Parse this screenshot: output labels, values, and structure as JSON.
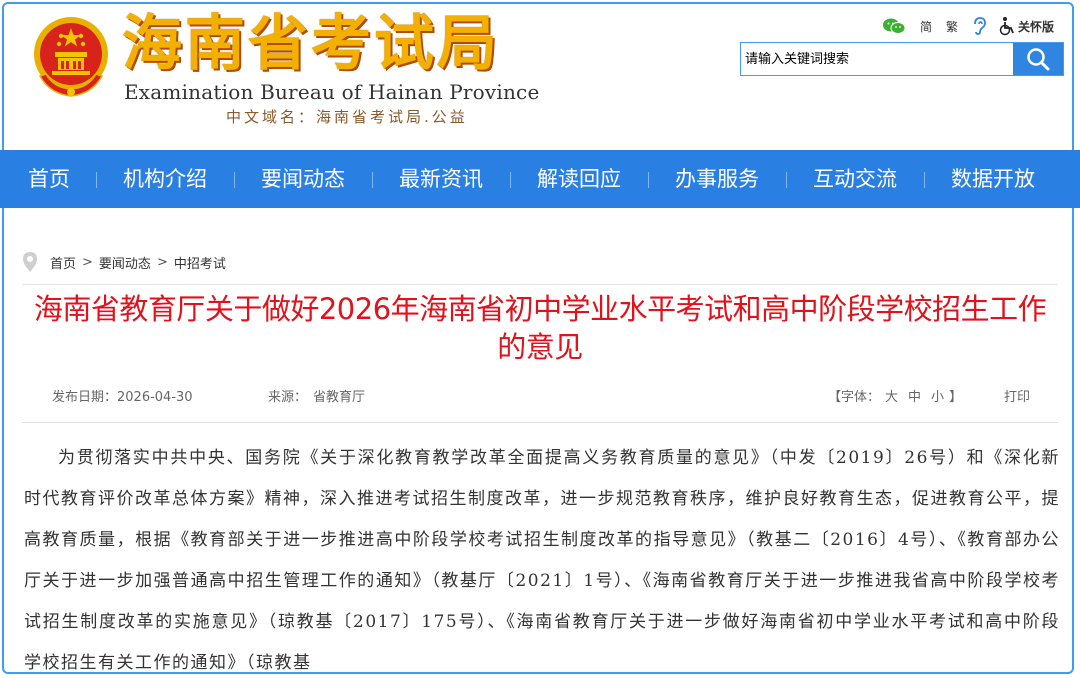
{
  "header": {
    "logo_cn": "海南省考试局",
    "logo_en": "Examination Bureau of Hainan Province",
    "domain": "中文域名：海南省考试局.公益",
    "tools": {
      "simplified": "简",
      "traditional": "繁",
      "care": "关怀版"
    },
    "search_placeholder": "请输入关键词搜索"
  },
  "nav": {
    "items": [
      "首页",
      "机构介绍",
      "要闻动态",
      "最新资讯",
      "解读回应",
      "办事服务",
      "互动交流",
      "数据开放"
    ]
  },
  "breadcrumb": {
    "items": [
      "首页",
      "要闻动态",
      "中招考试"
    ],
    "separator": ">"
  },
  "article": {
    "title": "海南省教育厅关于做好2026年海南省初中学业水平考试和高中阶段学校招生工作的意见",
    "date_label": "发布日期：",
    "date": "2026-04-30",
    "source_label": "来源：",
    "source": "省教育厅",
    "font_label_open": "【字体：",
    "font_large": "大",
    "font_medium": "中",
    "font_small": "小",
    "font_label_close": "】",
    "print": "打印",
    "body": "为贯彻落实中共中央、国务院《关于深化教育教学改革全面提高义务教育质量的意见》（中发〔2019〕26号）和《深化新时代教育评价改革总体方案》精神，深入推进考试招生制度改革，进一步规范教育秩序，维护良好教育生态，促进教育公平，提高教育质量，根据《教育部关于进一步推进高中阶段学校考试招生制度改革的指导意见》（教基二〔2016〕4号）、《教育部办公厅关于进一步加强普通高中招生管理工作的通知》（教基厅〔2021〕1号）、《海南省教育厅关于进一步推进我省高中阶段学校考试招生制度改革的实施意见》（琼教基〔2017〕175号）、《海南省教育厅关于进一步做好海南省初中学业水平考试和高中阶段学校招生有关工作的通知》（琼教基"
  },
  "colors": {
    "nav_bg": "#2980e2",
    "title_red": "#e0121b",
    "logo_gold": "#f2b100",
    "frame_blue": "#3d9df0"
  }
}
